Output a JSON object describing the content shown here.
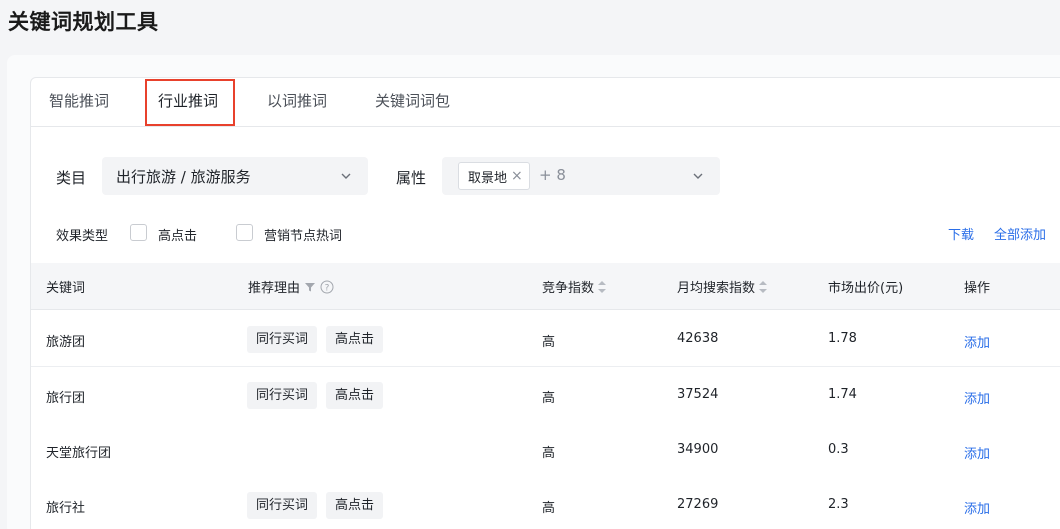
{
  "page_title": "关键词规划工具",
  "tabs": [
    {
      "label": "智能推词"
    },
    {
      "label": "行业推词"
    },
    {
      "label": "以词推词"
    },
    {
      "label": "关键词词包"
    }
  ],
  "active_tab": "行业推词",
  "filters": {
    "category_label": "类目",
    "category_value": "出行旅游 / 旅游服务",
    "attribute_label": "属性",
    "attribute_tag": "取景地",
    "attribute_more": "+ 8",
    "effect_type_label": "效果类型",
    "effect_options": [
      {
        "label": "高点击",
        "checked": false
      },
      {
        "label": "营销节点热词",
        "checked": false
      }
    ],
    "download_label": "下载",
    "add_all_label": "全部添加"
  },
  "table": {
    "columns": [
      "关键词",
      "推荐理由",
      "竞争指数",
      "月均搜索指数",
      "市场出价(元)",
      "操作"
    ],
    "rows": [
      {
        "keyword": "旅游团",
        "reasons": [
          "同行买词",
          "高点击"
        ],
        "competition": "高",
        "search_index": "42638",
        "bid": "1.78",
        "action": "添加"
      },
      {
        "keyword": "旅行团",
        "reasons": [
          "同行买词",
          "高点击"
        ],
        "competition": "高",
        "search_index": "37524",
        "bid": "1.74",
        "action": "添加"
      },
      {
        "keyword": "天堂旅行团",
        "reasons": [],
        "competition": "高",
        "search_index": "34900",
        "bid": "0.3",
        "action": "添加"
      },
      {
        "keyword": "旅行社",
        "reasons": [
          "同行买词",
          "高点击"
        ],
        "competition": "高",
        "search_index": "27269",
        "bid": "2.3",
        "action": "添加"
      }
    ]
  },
  "colors": {
    "link": "#2a6ee8",
    "tab_highlight": "#e8412c"
  }
}
